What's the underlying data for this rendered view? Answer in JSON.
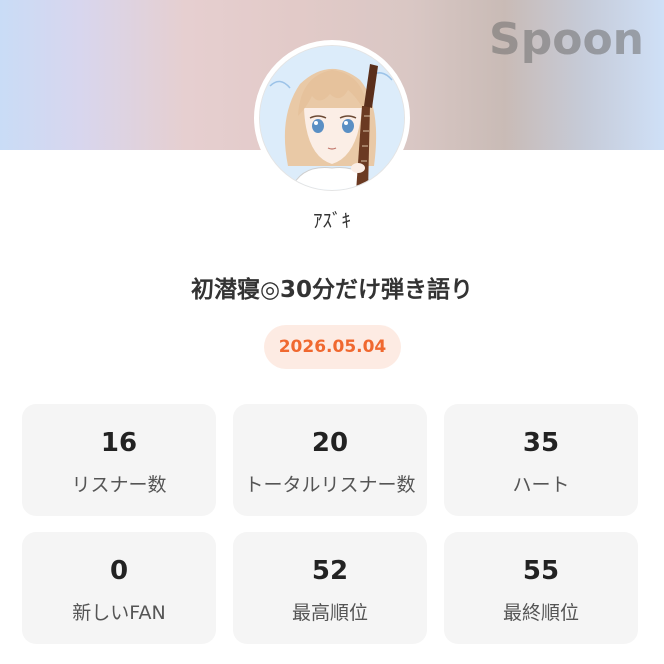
{
  "header": {
    "brand": "Spoon",
    "brand_color": "#6e6e6e"
  },
  "profile": {
    "avatar_icon": "guitar-girl-avatar",
    "username": "ｱｽﾞｷ"
  },
  "live": {
    "title": "初潜寝◎30分だけ弾き語り",
    "date": "2026.05.04",
    "date_color": "#f0682f"
  },
  "stats": [
    {
      "value": "16",
      "label": "リスナー数"
    },
    {
      "value": "20",
      "label": "トータルリスナー数"
    },
    {
      "value": "35",
      "label": "ハート"
    },
    {
      "value": "0",
      "label": "新しいFAN"
    },
    {
      "value": "52",
      "label": "最高順位"
    },
    {
      "value": "55",
      "label": "最終順位"
    }
  ]
}
